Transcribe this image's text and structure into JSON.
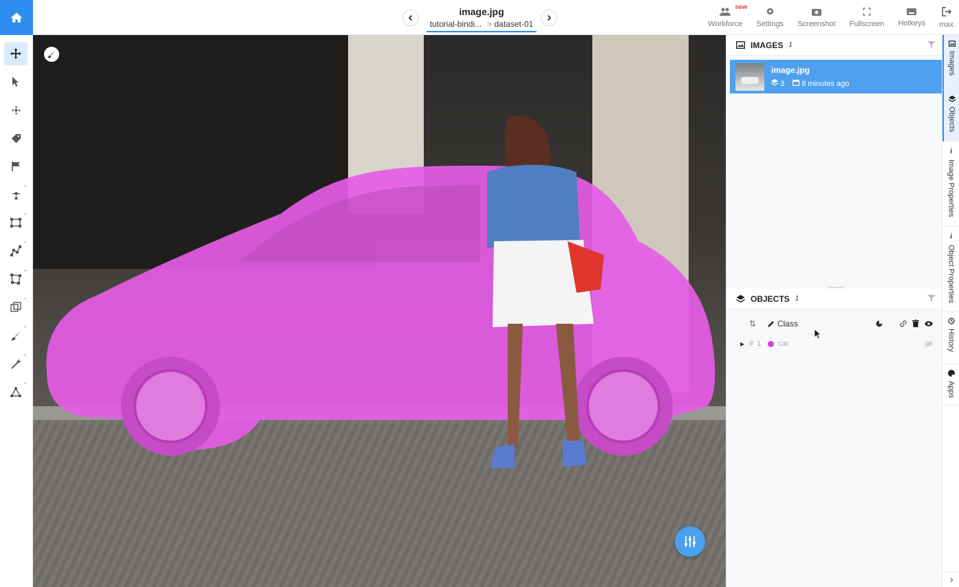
{
  "topbar": {
    "file_title": "image.jpg",
    "breadcrumb_project": "tutorial-bindi...",
    "breadcrumb_separator": ">",
    "breadcrumb_dataset": "dataset-01",
    "actions": [
      {
        "icon": "workforce-icon",
        "label": "Workforce",
        "badge": "new"
      },
      {
        "icon": "gear-icon",
        "label": "Settings"
      },
      {
        "icon": "camera-icon",
        "label": "Screenshot"
      },
      {
        "icon": "fullscreen-icon",
        "label": "Fullscreen"
      },
      {
        "icon": "keyboard-icon",
        "label": "Hotkeys"
      },
      {
        "icon": "logout-icon",
        "label": "max"
      }
    ]
  },
  "left_toolbar": {
    "tools": [
      "move-tool",
      "select-tool",
      "pan-tool",
      "tag-tool",
      "flag-tool",
      "point-tool",
      "rectangle-tool",
      "polyline-tool",
      "polygon-tool",
      "cuboid-tool",
      "brush-tool",
      "smart-tool",
      "graph-tool"
    ]
  },
  "images_panel": {
    "title": "IMAGES",
    "count": "1",
    "item": {
      "name": "image.jpg",
      "objects_count": "3",
      "time": "8 minutes ago"
    }
  },
  "objects_panel": {
    "title": "OBJECTS",
    "count": "1",
    "column_class": "Class",
    "rows": [
      {
        "hash": "#",
        "index": "1",
        "class": "car",
        "color": "#d63fd6"
      }
    ]
  },
  "right_tabs": [
    "Images",
    "Objects",
    "Image Properties",
    "Object Properties",
    "History",
    "Apps"
  ],
  "colors": {
    "accent": "#2d8ef0",
    "selected_item": "#4fa1ee",
    "mask": "#e65ce6"
  }
}
